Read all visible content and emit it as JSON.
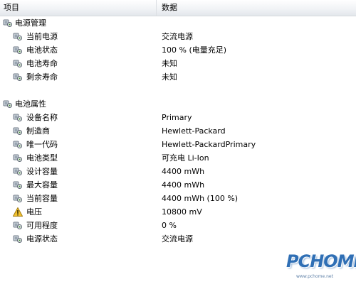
{
  "header": {
    "col_item": "项目",
    "col_data": "数据"
  },
  "sections": [
    {
      "name": "电源管理",
      "icon": "battery-icon",
      "rows": [
        {
          "label": "当前电源",
          "value": "交流电源",
          "icon": "battery-icon"
        },
        {
          "label": "电池状态",
          "value": "100 % (电量充足)",
          "icon": "battery-icon"
        },
        {
          "label": "电池寿命",
          "value": "未知",
          "icon": "battery-icon"
        },
        {
          "label": "剩余寿命",
          "value": "未知",
          "icon": "battery-icon"
        }
      ]
    },
    {
      "name": "电池属性",
      "icon": "battery-icon",
      "rows": [
        {
          "label": "设备名称",
          "value": "Primary",
          "icon": "battery-icon"
        },
        {
          "label": "制造商",
          "value": "Hewlett-Packard",
          "icon": "battery-icon"
        },
        {
          "label": "唯一代码",
          "value": "Hewlett-PackardPrimary",
          "icon": "battery-icon"
        },
        {
          "label": "电池类型",
          "value": "可充电 Li-Ion",
          "icon": "battery-icon"
        },
        {
          "label": "设计容量",
          "value": "4400 mWh",
          "icon": "battery-icon"
        },
        {
          "label": "最大容量",
          "value": "4400 mWh",
          "icon": "battery-icon"
        },
        {
          "label": "当前容量",
          "value": "4400 mWh  (100 %)",
          "icon": "battery-icon"
        },
        {
          "label": "电压",
          "value": "10800 mV",
          "icon": "warning-icon"
        },
        {
          "label": "可用程度",
          "value": "0 %",
          "icon": "battery-icon"
        },
        {
          "label": "电源状态",
          "value": "交流电源",
          "icon": "battery-icon"
        }
      ]
    }
  ],
  "watermark": {
    "brand": "PCHOME",
    "url": "www.pchome.net"
  }
}
